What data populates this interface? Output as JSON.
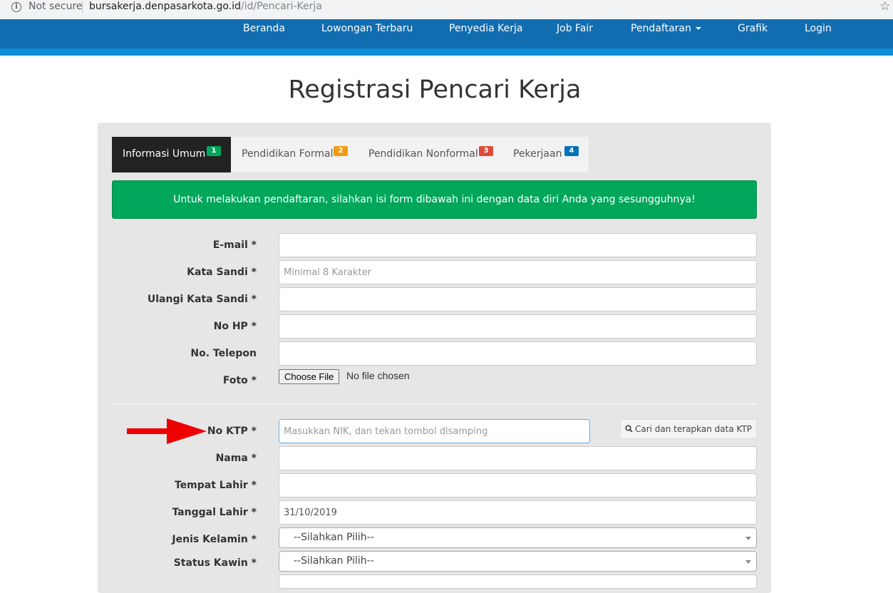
{
  "browser": {
    "security_label": "Not secure",
    "url_domain": "bursakerja.denpasarkota.go.id",
    "url_path": "/id/Pencari-Kerja"
  },
  "nav": {
    "items": [
      "Beranda",
      "Lowongan Terbaru",
      "Penyedia Kerja",
      "Job Fair",
      "Pendaftaran",
      "Grafik",
      "Login"
    ]
  },
  "page": {
    "title": "Registrasi Pencari Kerja"
  },
  "tabs": [
    {
      "label": "Informasi Umum",
      "badge": "1",
      "badge_color": "#00a65a"
    },
    {
      "label": "Pendidikan Formal",
      "badge": "2",
      "badge_color": "#f39c12"
    },
    {
      "label": "Pendidikan Nonformal",
      "badge": "3",
      "badge_color": "#dd4b39"
    },
    {
      "label": "Pekerjaan",
      "badge": "4",
      "badge_color": "#0073b7"
    }
  ],
  "alert": {
    "text": "Untuk melakukan pendaftaran, silahkan isi form dibawah ini dengan data diri Anda yang sesungguhnya!"
  },
  "form": {
    "email": {
      "label": "E-mail *",
      "value": "",
      "placeholder": ""
    },
    "password": {
      "label": "Kata Sandi *",
      "placeholder": "Minimal 8 Karakter"
    },
    "password_repeat": {
      "label": "Ulangi Kata Sandi *",
      "placeholder": ""
    },
    "phone_hp": {
      "label": "No HP *",
      "value": ""
    },
    "phone": {
      "label": "No. Telepon",
      "value": ""
    },
    "photo": {
      "label": "Foto *",
      "button": "Choose File",
      "status": "No file chosen"
    },
    "ktp": {
      "label": "No KTP *",
      "placeholder": "Masukkan NIK, dan tekan tombol disamping",
      "button": "Cari dan terapkan data KTP"
    },
    "name": {
      "label": "Nama *",
      "value": ""
    },
    "birthplace": {
      "label": "Tempat Lahir *",
      "value": ""
    },
    "birthdate": {
      "label": "Tanggal Lahir *",
      "value": "31/10/2019"
    },
    "gender": {
      "label": "Jenis Kelamin *",
      "selected": "--Silahkan Pilih--"
    },
    "marital": {
      "label": "Status Kawin *",
      "selected": "--Silahkan Pilih--"
    }
  },
  "colors": {
    "navbar": "#116db0",
    "nav_stripe": "#0e8fd8",
    "alert": "#00a65a",
    "arrow": "#ee0000"
  }
}
